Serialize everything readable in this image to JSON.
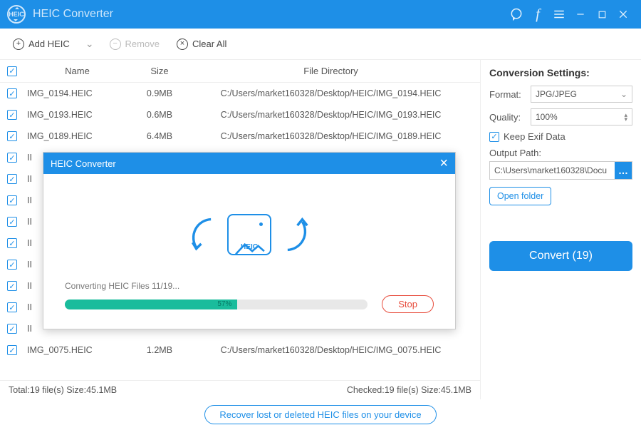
{
  "titlebar": {
    "title": "HEIC Converter",
    "logo_text": "HEIC"
  },
  "toolbar": {
    "add_label": "Add HEIC",
    "remove_label": "Remove",
    "clear_label": "Clear All"
  },
  "columns": {
    "name": "Name",
    "size": "Size",
    "dir": "File Directory"
  },
  "files": [
    {
      "name": "IMG_0194.HEIC",
      "size": "0.9MB",
      "dir": "C:/Users/market160328/Desktop/HEIC/IMG_0194.HEIC"
    },
    {
      "name": "IMG_0193.HEIC",
      "size": "0.6MB",
      "dir": "C:/Users/market160328/Desktop/HEIC/IMG_0193.HEIC"
    },
    {
      "name": "IMG_0189.HEIC",
      "size": "6.4MB",
      "dir": "C:/Users/market160328/Desktop/HEIC/IMG_0189.HEIC"
    },
    {
      "name": "II",
      "size": "",
      "dir": ""
    },
    {
      "name": "II",
      "size": "",
      "dir": ""
    },
    {
      "name": "II",
      "size": "",
      "dir": ""
    },
    {
      "name": "II",
      "size": "",
      "dir": ""
    },
    {
      "name": "II",
      "size": "",
      "dir": ""
    },
    {
      "name": "II",
      "size": "",
      "dir": ""
    },
    {
      "name": "II",
      "size": "",
      "dir": ""
    },
    {
      "name": "II",
      "size": "",
      "dir": ""
    },
    {
      "name": "II",
      "size": "",
      "dir": ""
    },
    {
      "name": "IMG_0075.HEIC",
      "size": "1.2MB",
      "dir": "C:/Users/market160328/Desktop/HEIC/IMG_0075.HEIC"
    }
  ],
  "status": {
    "total": "Total:19 file(s) Size:45.1MB",
    "checked": "Checked:19 file(s) Size:45.1MB"
  },
  "footer": {
    "recover": "Recover lost or deleted HEIC files on your device"
  },
  "settings": {
    "heading": "Conversion Settings:",
    "format_label": "Format:",
    "format_value": "JPG/JPEG",
    "quality_label": "Quality:",
    "quality_value": "100%",
    "keep_exif": "Keep Exif Data",
    "output_label": "Output Path:",
    "output_value": "C:\\Users\\market160328\\Docu",
    "open_folder": "Open folder",
    "convert": "Convert (19)"
  },
  "modal": {
    "title": "HEIC Converter",
    "box_label": "HEIC",
    "progress_text": "Converting HEIC Files 11/19...",
    "progress_pct_label": "57%",
    "progress_pct": 57,
    "stop": "Stop"
  }
}
